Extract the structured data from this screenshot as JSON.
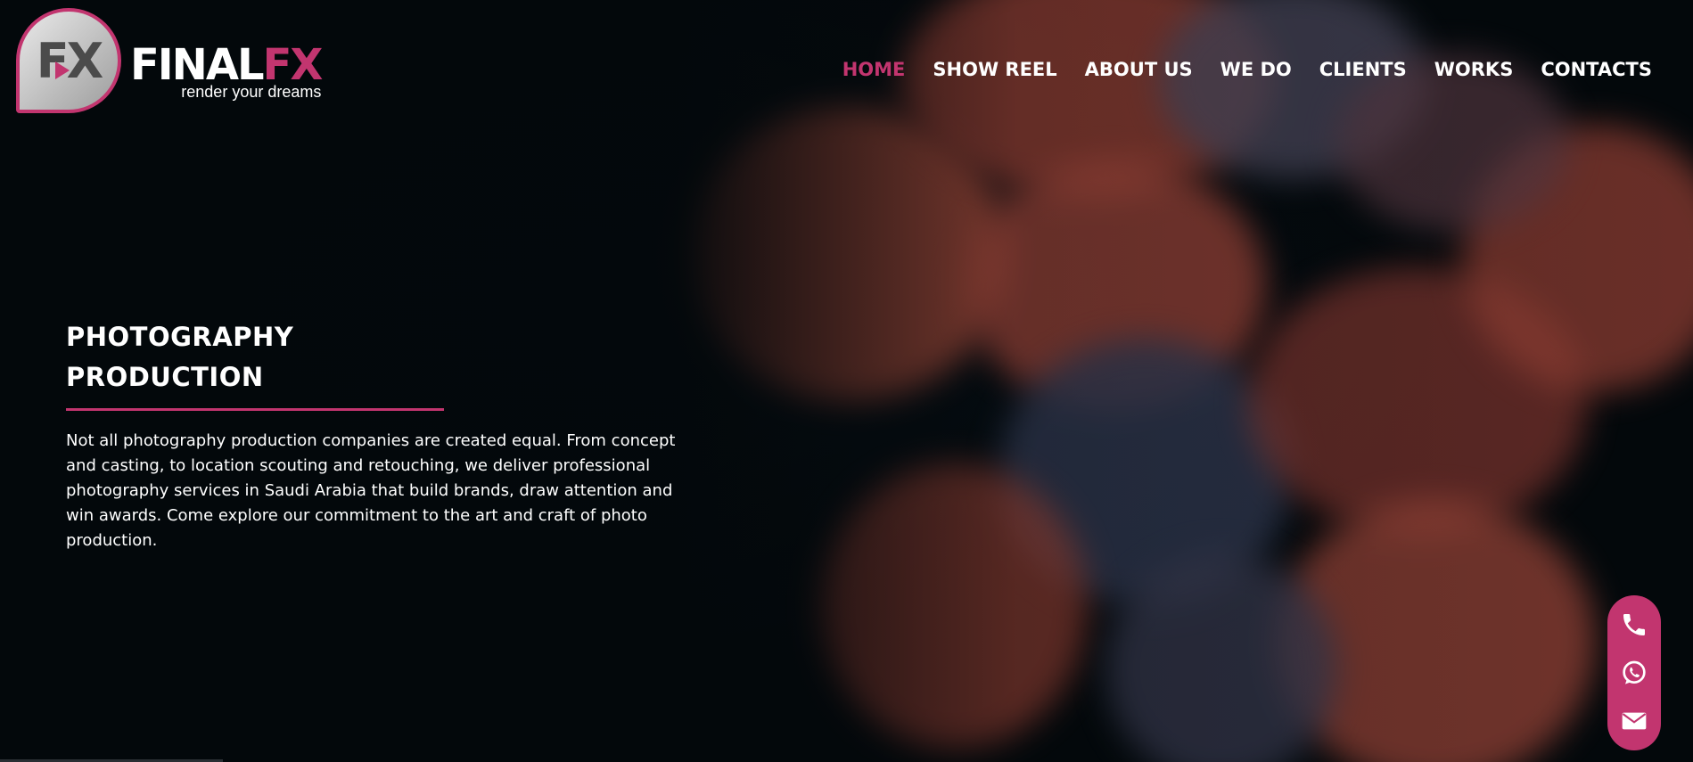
{
  "brand": {
    "badge_text": "FX",
    "name_part1": "FINAL",
    "name_part2": "FX",
    "tagline": "render your dreams"
  },
  "nav": {
    "items": [
      {
        "label": "HOME",
        "active": true
      },
      {
        "label": "SHOW REEL",
        "active": false
      },
      {
        "label": "ABOUT US",
        "active": false
      },
      {
        "label": "WE DO",
        "active": false
      },
      {
        "label": "CLIENTS",
        "active": false
      },
      {
        "label": "WORKS",
        "active": false
      },
      {
        "label": "CONTACTS",
        "active": false
      }
    ]
  },
  "hero": {
    "title_line1": "PHOTOGRAPHY",
    "title_line2": "PRODUCTION",
    "description": "Not all photography production companies are created equal. From concept and casting, to location scouting and retouching, we deliver professional photography services in Saudi Arabia that build brands, draw attention and win awards. Come explore our commitment to the art and craft of photo production."
  },
  "contact_dock": {
    "icons": [
      "phone-icon",
      "whatsapp-icon",
      "envelope-icon"
    ]
  },
  "colors": {
    "accent": "#c2356f",
    "background": "#03080b",
    "text": "#ffffff"
  }
}
